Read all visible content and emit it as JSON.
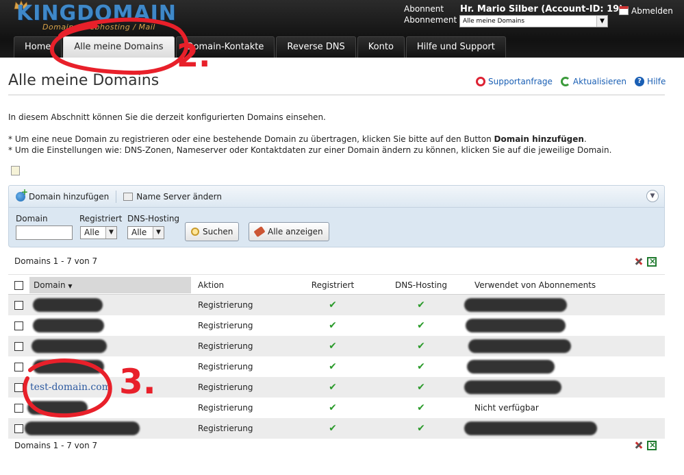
{
  "header": {
    "logo_text": "KINGDOMAIN",
    "logo_tagline": "Domain / Webhosting / Mail",
    "account_label": "Abonnent",
    "account_value": "Hr. Mario Silber (Account-ID: 19)",
    "subscription_label": "Abonnement",
    "subscription_value": "Alle meine Domains",
    "logout_label": "Abmelden"
  },
  "nav": {
    "tabs": [
      {
        "label": "Home",
        "active": false
      },
      {
        "label": "Alle meine Domains",
        "active": true
      },
      {
        "label": "Domain-Kontakte",
        "active": false
      },
      {
        "label": "Reverse DNS",
        "active": false
      },
      {
        "label": "Konto",
        "active": false
      },
      {
        "label": "Hilfe und Support",
        "active": false
      }
    ]
  },
  "page": {
    "title": "Alle meine Domains",
    "actions": {
      "support": "Supportanfrage",
      "refresh": "Aktualisieren",
      "help": "Hilfe"
    },
    "intro": "In diesem Abschnitt können Sie die derzeit konfigurierten Domains einsehen.",
    "note1_pre": "* Um eine neue Domain zu registrieren oder eine bestehende Domain zu übertragen, klicken Sie bitte auf den Button ",
    "note1_bold": "Domain hinzufügen",
    "note1_post": ".",
    "note2": "* Um die Einstellungen wie: DNS-Zonen, Nameserver oder Kontaktdaten zur einer Domain ändern zu können, klicken Sie auf die jeweilige Domain."
  },
  "toolbar": {
    "add_domain": "Domain hinzufügen",
    "change_ns": "Name Server ändern"
  },
  "filter": {
    "domain_label": "Domain",
    "domain_value": "",
    "registered_label": "Registriert",
    "registered_value": "Alle",
    "dns_label": "DNS-Hosting",
    "dns_value": "Alle",
    "search_button": "Suchen",
    "show_all_button": "Alle anzeigen"
  },
  "table": {
    "count": "Domains 1 - 7 von 7",
    "headers": {
      "domain": "Domain",
      "aktion": "Aktion",
      "registriert": "Registriert",
      "dns": "DNS-Hosting",
      "used_by": "Verwendet von Abonnements"
    },
    "rows": [
      {
        "domain": "",
        "aktion": "Registrierung",
        "registered": true,
        "dns": true,
        "used_by": ""
      },
      {
        "domain": "",
        "aktion": "Registrierung",
        "registered": true,
        "dns": true,
        "used_by": ""
      },
      {
        "domain": "",
        "aktion": "Registrierung",
        "registered": true,
        "dns": true,
        "used_by": ""
      },
      {
        "domain": "",
        "aktion": "Registrierung",
        "registered": true,
        "dns": true,
        "used_by": ""
      },
      {
        "domain": "test-domain.com",
        "aktion": "Registrierung",
        "registered": true,
        "dns": true,
        "used_by": ""
      },
      {
        "domain": "",
        "aktion": "Registrierung",
        "registered": true,
        "dns": true,
        "used_by": "Nicht verfügbar"
      },
      {
        "domain": "",
        "aktion": "Registrierung",
        "registered": true,
        "dns": true,
        "used_by": ""
      }
    ],
    "tick_glyph": "✔"
  },
  "annotations": {
    "mark_2": "2.",
    "mark_3": "3.",
    "color": "#e8202a"
  }
}
